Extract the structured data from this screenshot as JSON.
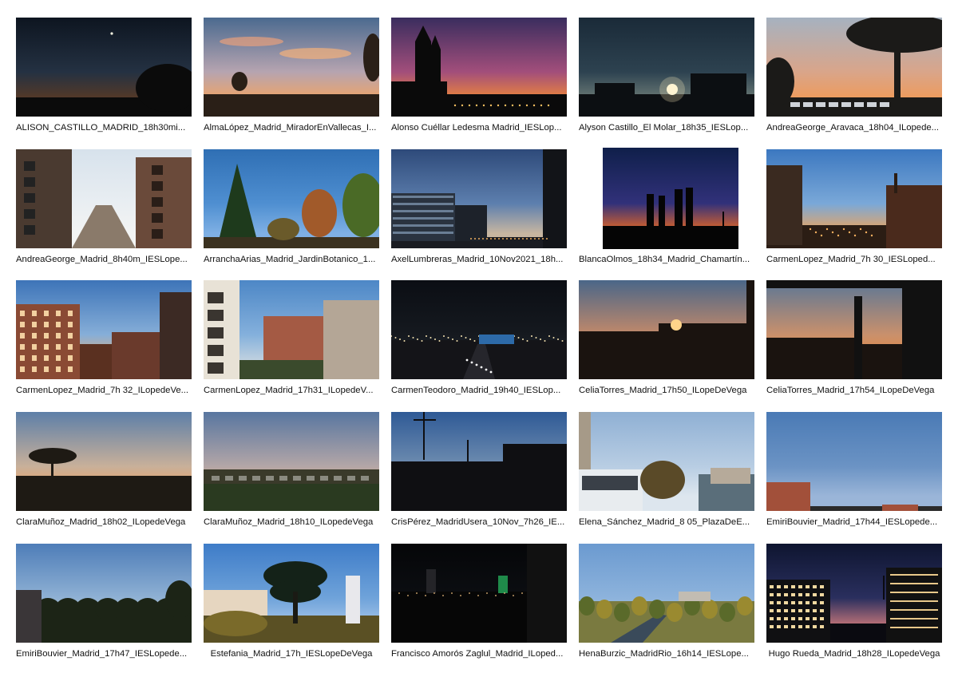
{
  "photos": [
    {
      "caption": "ALISON_CASTILLO_MADRID_18h30mi...",
      "sky": [
        "#0d1520",
        "#243142",
        "#5a3a24"
      ],
      "ground": "#0b0b0b",
      "subject": "tree-right-moon"
    },
    {
      "caption": "AlmaLópez_Madrid_MiradorEnVallecas_I...",
      "sky": [
        "#4b6a8f",
        "#b6a4b0",
        "#f2a463"
      ],
      "ground": "#2a1f17",
      "subject": "clouds-tree"
    },
    {
      "caption": "Alonso Cuéllar Ledesma Madrid_IESLop...",
      "sky": [
        "#3a2d5e",
        "#a24e7b",
        "#f28a36"
      ],
      "ground": "#0a0a0a",
      "subject": "cathedral"
    },
    {
      "caption": "Alyson Castillo_El Molar_18h35_IESLop...",
      "sky": [
        "#1a2a38",
        "#2d4250",
        "#6f7e78"
      ],
      "ground": "#0c0f12",
      "subject": "moonrise"
    },
    {
      "caption": "AndreaGeorge_Aravaca_18h04_ILopede...",
      "sky": [
        "#a6b2c0",
        "#d9a58a",
        "#f09a57"
      ],
      "ground": "#1b1a18",
      "subject": "pine-parking"
    },
    {
      "caption": "AndreaGeorge_Madrid_8h40m_IESLope...",
      "sky": [
        "#d7e2ec",
        "#e9eef2",
        "#f3f4f3"
      ],
      "ground": "#5b4a3c",
      "subject": "street"
    },
    {
      "caption": "ArranchaArias_Madrid_JardinBotanico_1...",
      "sky": [
        "#2f6fb4",
        "#4f8fd1",
        "#7fb0e4"
      ],
      "ground": "#3a4a2a",
      "subject": "botanic"
    },
    {
      "caption": "AxelLumbreras_Madrid_10Nov2021_18h...",
      "sky": [
        "#2e4a7a",
        "#5d7fae",
        "#c7b6a1"
      ],
      "ground": "#1a1c22",
      "subject": "offices"
    },
    {
      "caption": "BlancaOlmos_18h34_Madrid_Chamartín...",
      "sky": [
        "#0f1f4a",
        "#31317a",
        "#f26a1e"
      ],
      "ground": "#050505",
      "subject": "towers",
      "portrait": true
    },
    {
      "caption": "CarmenLopez_Madrid_7h 30_IESLoped...",
      "sky": [
        "#3c78c0",
        "#7aa8d8",
        "#f0a55a"
      ],
      "ground": "#2b1d14",
      "subject": "city-dawn"
    },
    {
      "caption": "CarmenLopez_Madrid_7h 32_ILopedeVe...",
      "sky": [
        "#3d74b8",
        "#86aed8",
        "#f1b06a"
      ],
      "ground": "#4a2d20",
      "subject": "buildings-left"
    },
    {
      "caption": "CarmenLopez_Madrid_17h31_ILopedeV...",
      "sky": [
        "#4d87c6",
        "#84b0dc",
        "#c9d6e0"
      ],
      "ground": "#5a4e3e",
      "subject": "buildings-mix"
    },
    {
      "caption": "CarmenTeodoro_Madrid_19h40_IESLop...",
      "sky": [
        "#0b0e14",
        "#15191f",
        "#232a33"
      ],
      "ground": "#0d0d10",
      "subject": "highway-night"
    },
    {
      "caption": "CeliaTorres_Madrid_17h50_ILopeDeVega",
      "sky": [
        "#4a6688",
        "#c2896a",
        "#f0842a"
      ],
      "ground": "#1a130f",
      "subject": "sunset-city"
    },
    {
      "caption": "CeliaTorres_Madrid_17h54_ILopeDeVega",
      "sky": [
        "#5a7696",
        "#c9906c",
        "#ee8a3a"
      ],
      "ground": "#1a130f",
      "subject": "window"
    },
    {
      "caption": "ClaraMuñoz_Madrid_18h02_ILopedeVega",
      "sky": [
        "#5d7fa8",
        "#c8b09a",
        "#f3a15a"
      ],
      "ground": "#1e1a14",
      "subject": "lone-tree"
    },
    {
      "caption": "ClaraMuñoz_Madrid_18h10_ILopedeVega",
      "sky": [
        "#5876a0",
        "#b3a6a7",
        "#f0b070"
      ],
      "ground": "#2a2a20",
      "subject": "valley"
    },
    {
      "caption": "CrisPérez_MadridUsera_10Nov_7h26_IE...",
      "sky": [
        "#2f5a96",
        "#6f8db0",
        "#f0a24a"
      ],
      "ground": "#0f0f12",
      "subject": "antennas"
    },
    {
      "caption": "Elena_Sánchez_Madrid_8 05_PlazaDeE...",
      "sky": [
        "#8fb0d4",
        "#b8cde3",
        "#dde6ee"
      ],
      "ground": "#4a4640",
      "subject": "bus-street"
    },
    {
      "caption": "EmiriBouvier_Madrid_17h44_IESLopede...",
      "sky": [
        "#4a7ab5",
        "#6b93c4",
        "#9ab5d8"
      ],
      "ground": "#8a3a25",
      "subject": "rooftop"
    },
    {
      "caption": "EmiriBouvier_Madrid_17h47_IESLopede...",
      "sky": [
        "#4e7db8",
        "#8fb1d4",
        "#e8c79a"
      ],
      "ground": "#1c2416",
      "subject": "treeline"
    },
    {
      "caption": "Estefania_Madrid_17h_IESLopeDeVega",
      "sky": [
        "#3e7cc8",
        "#6fa3da",
        "#a9c8ea"
      ],
      "ground": "#2a3a1e",
      "subject": "cedar",
      "center": true
    },
    {
      "caption": "Francisco Amorós Zaglul_Madrid_ILoped...",
      "sky": [
        "#050608",
        "#0c0e12",
        "#15181e"
      ],
      "ground": "#060606",
      "subject": "night-city"
    },
    {
      "caption": "HenaBurzic_MadridRio_16h14_IESLope...",
      "sky": [
        "#6b9ad0",
        "#8db3dc",
        "#b9d0ea"
      ],
      "ground": "#6a7a3a",
      "subject": "river"
    },
    {
      "caption": "Hugo Rueda_Madrid_18h28_ILopedeVega",
      "sky": [
        "#0e1530",
        "#2a2f5e",
        "#c9787a"
      ],
      "ground": "#0a0a10",
      "subject": "offices-night",
      "center": true
    }
  ]
}
